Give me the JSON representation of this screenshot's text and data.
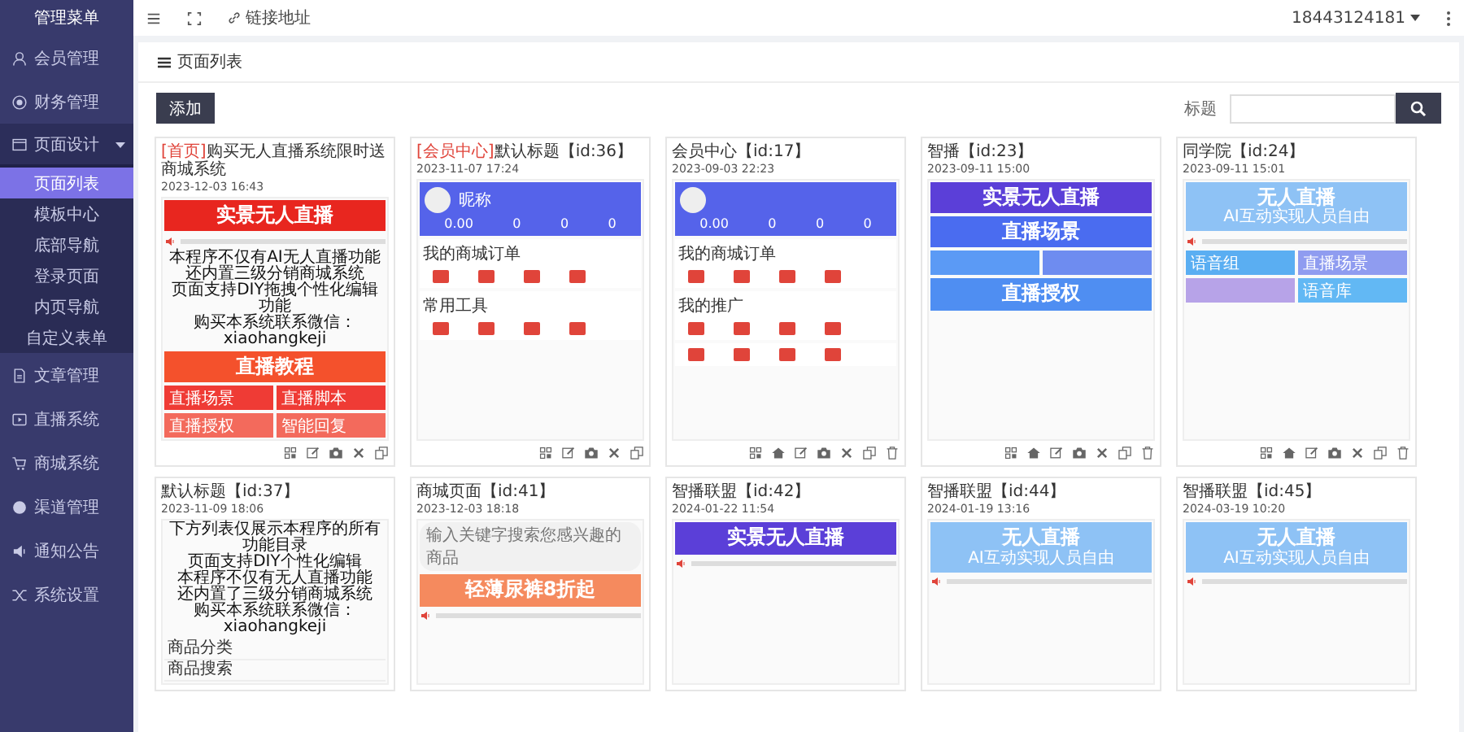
{
  "sidebar": {
    "title": "管理菜单",
    "items": [
      {
        "label": "会员管理",
        "selected": false
      },
      {
        "label": "财务管理",
        "selected": false
      },
      {
        "label": "页面设计",
        "expanded": true,
        "selected": false,
        "children": [
          {
            "label": "页面列表",
            "selected": true
          },
          {
            "label": "模板中心",
            "selected": false
          },
          {
            "label": "底部导航",
            "selected": false
          },
          {
            "label": "登录页面",
            "selected": false
          },
          {
            "label": "内页导航",
            "selected": false
          },
          {
            "label": "自定义表单",
            "selected": false
          }
        ]
      },
      {
        "label": "文章管理",
        "selected": false
      },
      {
        "label": "直播系统",
        "selected": false
      },
      {
        "label": "商城系统",
        "selected": false
      },
      {
        "label": "渠道管理",
        "selected": false
      },
      {
        "label": "通知公告",
        "selected": false
      },
      {
        "label": "系统设置",
        "selected": false
      }
    ]
  },
  "topbar": {
    "link": "链接地址",
    "user": "18443124181"
  },
  "panel": {
    "title": "页面列表",
    "add_button": "添加",
    "search_label": "标题"
  },
  "cards": [
    {
      "tag": "[首页]",
      "title": "购买无人直播系统限时送商城系统",
      "date": "2023-12-03 16:43",
      "actions": [
        {
          "kind": "qr"
        },
        {
          "kind": "edit"
        },
        {
          "kind": "camera"
        },
        {
          "kind": "close"
        },
        {
          "kind": "copy"
        }
      ],
      "preview": [
        {
          "kind": "banner",
          "text": "实景无人直播",
          "color": "#e8261f"
        },
        {
          "kind": "notice"
        },
        {
          "kind": "lines",
          "lines": [
            "本程序不仅有AI无人直播功能",
            "还内置三级分销商城系统",
            "页面支持DIY拖拽个性化编辑功能",
            "购买本系统联系微信：xiaohangkeji"
          ]
        },
        {
          "kind": "banner",
          "text": "直播教程",
          "color": "#f4512c"
        },
        {
          "kind": "tiles",
          "tiles": [
            {
              "text": "直播场景",
              "color": "#ef3b35"
            },
            {
              "text": "直播脚本",
              "color": "#ef3b35"
            },
            {
              "text": "直播授权",
              "color": "#f36a5c"
            },
            {
              "text": "智能回复",
              "color": "#f36a5c"
            }
          ]
        }
      ]
    },
    {
      "tag": "[会员中心]",
      "title": "默认标题【id:36】",
      "date": "2023-11-07 17:24",
      "actions": [
        {
          "kind": "qr"
        },
        {
          "kind": "edit"
        },
        {
          "kind": "camera"
        },
        {
          "kind": "close"
        },
        {
          "kind": "copy"
        }
      ],
      "preview": [
        {
          "kind": "profile",
          "name": "昵称",
          "stats": [
            "0.00",
            "0",
            "0",
            "0"
          ]
        },
        {
          "kind": "section",
          "title": "我的商城订单"
        },
        {
          "kind": "section",
          "title": "常用工具"
        }
      ]
    },
    {
      "title": "会员中心【id:17】",
      "date": "2023-09-03 22:23",
      "actions": [
        {
          "kind": "qr"
        },
        {
          "kind": "home"
        },
        {
          "kind": "edit"
        },
        {
          "kind": "camera"
        },
        {
          "kind": "close"
        },
        {
          "kind": "copy"
        },
        {
          "kind": "trash"
        }
      ],
      "preview": [
        {
          "kind": "profile",
          "stats": [
            "0.00",
            "0",
            "0",
            "0"
          ]
        },
        {
          "kind": "section",
          "title": "我的商城订单"
        },
        {
          "kind": "section",
          "title": "我的推广"
        },
        {
          "kind": "section"
        }
      ]
    },
    {
      "title": "智播【id:23】",
      "date": "2023-09-11 15:00",
      "actions": [
        {
          "kind": "qr"
        },
        {
          "kind": "home"
        },
        {
          "kind": "edit"
        },
        {
          "kind": "camera"
        },
        {
          "kind": "close"
        },
        {
          "kind": "copy"
        },
        {
          "kind": "trash"
        }
      ],
      "preview": [
        {
          "kind": "banner",
          "text": "实景无人直播",
          "color": "#5b3fd8"
        },
        {
          "kind": "banner",
          "text": "直播场景",
          "color": "#4a6cf0"
        },
        {
          "kind": "tiles",
          "tiles": [
            {
              "color": "#5b9af5"
            },
            {
              "color": "#6e8cf0"
            }
          ]
        },
        {
          "kind": "banner",
          "text": "直播授权",
          "color": "#4f8ef2"
        }
      ]
    },
    {
      "title": "同学院【id:24】",
      "date": "2023-09-11 15:01",
      "actions": [
        {
          "kind": "qr"
        },
        {
          "kind": "home"
        },
        {
          "kind": "edit"
        },
        {
          "kind": "camera"
        },
        {
          "kind": "close"
        },
        {
          "kind": "copy"
        },
        {
          "kind": "trash"
        }
      ],
      "preview": [
        {
          "kind": "banner",
          "text": "无人直播",
          "subtitle": "AI互动实现人员自由",
          "color": "#8ec2f5"
        },
        {
          "kind": "notice"
        },
        {
          "kind": "tiles",
          "tiles": [
            {
              "text": "语音组",
              "color": "#5aaef2"
            },
            {
              "text": "直播场景",
              "color": "#8f9cf0"
            },
            {
              "color": "#b7a3e8"
            },
            {
              "text": "语音库",
              "color": "#62b8f4"
            }
          ]
        }
      ]
    },
    {
      "title": "默认标题【id:37】",
      "date": "2023-11-09 18:06",
      "preview": [
        {
          "kind": "lines",
          "lines": [
            "下方列表仅展示本程序的所有功能目录",
            "页面支持DIY个性化编辑",
            "本程序不仅有无人直播功能",
            "还内置了三级分销商城系统",
            "购买本系统联系微信：xiaohangkeji"
          ]
        },
        {
          "kind": "list",
          "rows": [
            "商品分类",
            "商品搜索"
          ]
        }
      ]
    },
    {
      "title": "商城页面【id:41】",
      "date": "2023-12-03 18:18",
      "preview": [
        {
          "kind": "search",
          "text": "输入关键字搜索您感兴趣的商品"
        },
        {
          "kind": "banner",
          "text": "轻薄尿裤8折起",
          "color": "#f58a5e"
        },
        {
          "kind": "notice"
        }
      ]
    },
    {
      "title": "智播联盟【id:42】",
      "date": "2024-01-22 11:54",
      "preview": [
        {
          "kind": "banner",
          "text": "实景无人直播",
          "color": "#5b3fd8"
        },
        {
          "kind": "notice"
        }
      ]
    },
    {
      "title": "智播联盟【id:44】",
      "date": "2024-01-19 13:16",
      "preview": [
        {
          "kind": "banner",
          "text": "无人直播",
          "subtitle": "AI互动实现人员自由",
          "color": "#8ec2f5"
        },
        {
          "kind": "notice"
        }
      ]
    },
    {
      "title": "智播联盟【id:45】",
      "date": "2024-03-19 10:20",
      "preview": [
        {
          "kind": "banner",
          "text": "无人直播",
          "subtitle": "AI互动实现人员自由",
          "color": "#8ec2f5"
        },
        {
          "kind": "notice"
        }
      ]
    }
  ]
}
